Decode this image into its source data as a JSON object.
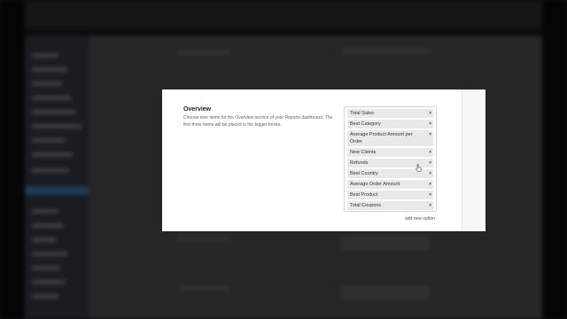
{
  "section": {
    "title": "Overview",
    "description": "Choose nine items for the Overview section of your Reports dashboard. The first three items will be placed in the bigger boxes."
  },
  "options": [
    {
      "label": "Total Sales"
    },
    {
      "label": "Best Category"
    },
    {
      "label": "Average Product Amount per Order"
    },
    {
      "label": "New Clients"
    },
    {
      "label": "Refunds"
    },
    {
      "label": "Best Country"
    },
    {
      "label": "Average Order Amount"
    },
    {
      "label": "Best Product"
    },
    {
      "label": "Total Coupons"
    }
  ],
  "remove_symbol": "×",
  "add_link": "add new option"
}
